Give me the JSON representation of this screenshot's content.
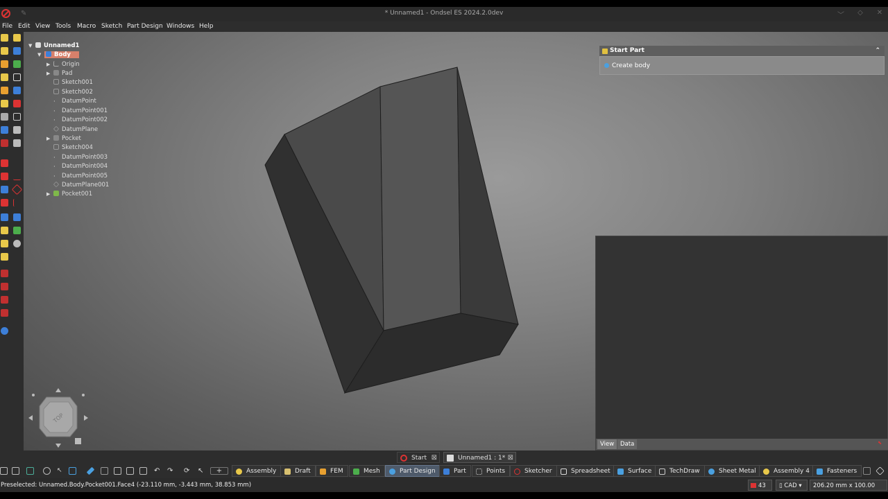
{
  "window": {
    "title": "* Unnamed1 - Ondsel ES 2024.2.0dev"
  },
  "menu": [
    "File",
    "Edit",
    "View",
    "Tools",
    "Macro",
    "Sketch",
    "Part Design",
    "Windows",
    "Help"
  ],
  "tree": {
    "root": "Unnamed1",
    "body": "Body",
    "items": [
      "Origin",
      "Pad",
      "Sketch001",
      "Sketch002",
      "DatumPoint",
      "DatumPoint001",
      "DatumPoint002",
      "DatumPlane",
      "Pocket",
      "Sketch004",
      "DatumPoint003",
      "DatumPoint004",
      "DatumPoint005",
      "DatumPlane001",
      "Pocket001"
    ]
  },
  "task_panel": {
    "title": "Start Part",
    "action": "Create body"
  },
  "property_panel": {
    "tabs": [
      "View",
      "Data"
    ]
  },
  "navcube": {
    "face_label": "TOP"
  },
  "doc_tabs": [
    {
      "label": "Start"
    },
    {
      "label": "Unnamed1 : 1*"
    }
  ],
  "workbenches": [
    "Assembly",
    "Draft",
    "FEM",
    "Mesh",
    "Part Design",
    "Part",
    "Points",
    "Sketcher",
    "Spreadsheet",
    "Surface",
    "TechDraw",
    "Sheet Metal",
    "Assembly 4",
    "Fasteners"
  ],
  "active_workbench": "Part Design",
  "status": {
    "message": "Preselected: Unnamed.Body.Pocket001.Face4 (-23.110 mm, -3.443 mm, 38.853 mm)",
    "count": "43",
    "nav_style": "CAD",
    "dimensions": "206.20 mm x 100.00 mm"
  }
}
